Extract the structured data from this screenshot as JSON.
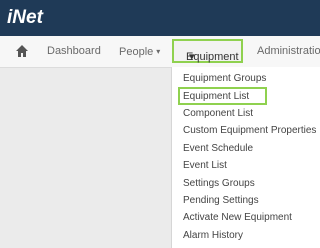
{
  "app": {
    "logo_text": "iNet"
  },
  "nav": {
    "home_icon": "home-icon",
    "items": [
      {
        "label": "Dashboard"
      },
      {
        "label": "People"
      },
      {
        "label": "Equipment"
      },
      {
        "label": "Administration"
      }
    ],
    "caret_glyph": "▾"
  },
  "dropdown": {
    "items": [
      {
        "label": "Equipment Groups"
      },
      {
        "label": "Equipment List"
      },
      {
        "label": "Component List"
      },
      {
        "label": "Custom Equipment Properties"
      },
      {
        "label": "Event Schedule"
      },
      {
        "label": "Event List"
      },
      {
        "label": "Settings Groups"
      },
      {
        "label": "Pending Settings"
      },
      {
        "label": "Activate New Equipment"
      },
      {
        "label": "Alarm History"
      }
    ]
  },
  "colors": {
    "topbar": "#1f3a57",
    "highlight": "#8fd14f"
  }
}
